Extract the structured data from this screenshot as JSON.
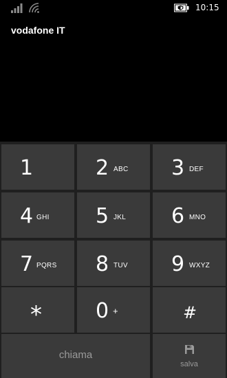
{
  "status_bar": {
    "signal_icon": "signal-strength-icon",
    "wifi_icon": "wifi-icon",
    "battery_icon": "battery-saver-icon",
    "time": "10:15"
  },
  "carrier": "vodafone IT",
  "keypad": {
    "keys": [
      {
        "digit": "1",
        "letters": ""
      },
      {
        "digit": "2",
        "letters": "ABC"
      },
      {
        "digit": "3",
        "letters": "DEF"
      },
      {
        "digit": "4",
        "letters": "GHI"
      },
      {
        "digit": "5",
        "letters": "JKL"
      },
      {
        "digit": "6",
        "letters": "MNO"
      },
      {
        "digit": "7",
        "letters": "PQRS"
      },
      {
        "digit": "8",
        "letters": "TUV"
      },
      {
        "digit": "9",
        "letters": "WXYZ"
      },
      {
        "digit": "*",
        "letters": ""
      },
      {
        "digit": "0",
        "letters": "+"
      },
      {
        "digit": "#",
        "letters": ""
      }
    ],
    "call_label": "chiama",
    "save_label": "salva",
    "save_icon": "floppy-disk-icon"
  }
}
